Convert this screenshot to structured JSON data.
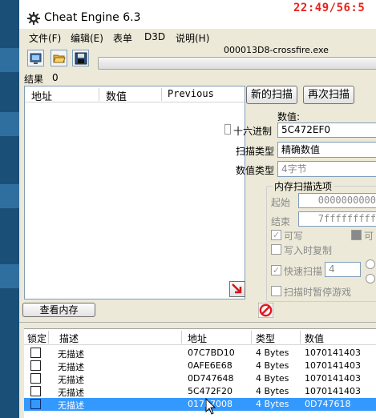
{
  "window": {
    "title": "Cheat Engine 6.3",
    "clock": "22:49/56:5",
    "process_name": "000013D8-crossfire.exe"
  },
  "menu": [
    "文件(F)",
    "编辑(E)",
    "表单",
    "D3D",
    "说明(H)"
  ],
  "toolbar": {
    "icons": [
      "open-process-icon",
      "open-file-icon",
      "save-icon"
    ]
  },
  "results": {
    "label": "结果",
    "count": "0",
    "columns": [
      "地址",
      "数值",
      "Previous"
    ]
  },
  "scan": {
    "new_scan": "新的扫描",
    "next_scan": "再次扫描",
    "value_label": "数值:",
    "hex_label": "十六进制",
    "value": "5C472EF0",
    "scan_type_label": "扫描类型",
    "scan_type": "精确数值",
    "value_type_label": "数值类型",
    "value_type": "4字节",
    "mem_options_title": "内存扫描选项",
    "start_label": "起始",
    "start_value": "0000000000",
    "stop_label": "结束",
    "stop_value": "7fffffffff",
    "writable_label": "可写",
    "executable_label": "可",
    "copy_on_write_label": "写入时复制",
    "fast_scan_label": "快速扫描",
    "fast_scan_value": "4",
    "pause_label": "扫描时暂停游戏"
  },
  "memory_view_button": "查看内存",
  "table": {
    "columns": [
      "锁定",
      "描述",
      "地址",
      "类型",
      "数值"
    ],
    "rows": [
      {
        "desc": "无描述",
        "address": "07C7BD10",
        "type": "4 Bytes",
        "value": "1070141403",
        "selected": false
      },
      {
        "desc": "无描述",
        "address": "0AFE6E68",
        "type": "4 Bytes",
        "value": "1070141403",
        "selected": false
      },
      {
        "desc": "无描述",
        "address": "0D747648",
        "type": "4 Bytes",
        "value": "1070141403",
        "selected": false
      },
      {
        "desc": "无描述",
        "address": "5C472F20",
        "type": "4 Bytes",
        "value": "1070141403",
        "selected": false
      },
      {
        "desc": "无描述",
        "address": "017E7008",
        "type": "4 Bytes",
        "value": "0D747618",
        "selected": true
      }
    ]
  },
  "colors": {
    "clock": "#e8231b",
    "selection": "#3399ff",
    "window_bg": "#ece9d8",
    "desktop": "#1a4f78"
  }
}
